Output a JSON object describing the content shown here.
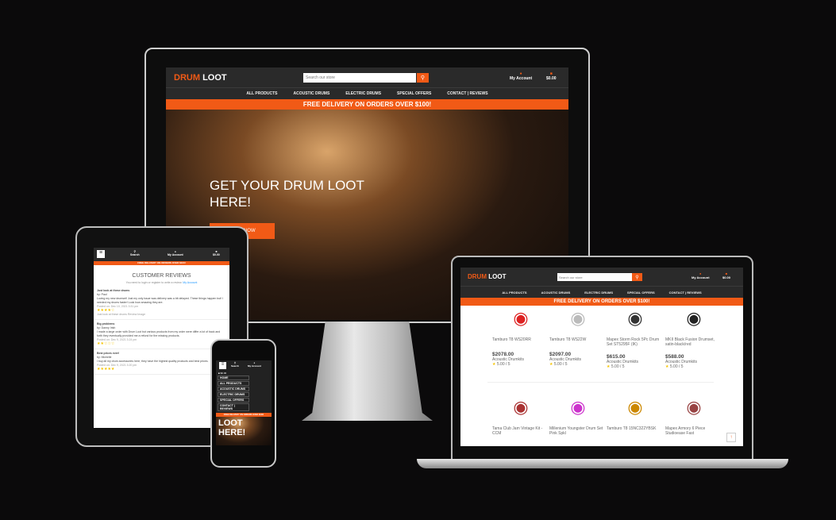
{
  "brand": {
    "part1": "DRUM",
    "part2": "LOOT",
    "accent": "#f15a16"
  },
  "search": {
    "placeholder": "Search our store"
  },
  "header": {
    "account": "My Account",
    "cart": "$0.00",
    "search_label": "Search"
  },
  "nav": [
    "ALL PRODUCTS",
    "ACOUSTIC DRUMS",
    "ELECTRIC DRUMS",
    "SPECIAL OFFERS",
    "CONTACT | REVIEWS"
  ],
  "banner": "FREE DELIVERY ON ORDERS OVER $100!",
  "hero": {
    "title": "GET YOUR DRUM LOOT HERE!",
    "cta": "SHOP NOW"
  },
  "products": [
    {
      "name": "Tamburo T8 WS20RR",
      "price": "$2078.00",
      "category": "Acoustic Drumkits",
      "rating": "5.00 / 5"
    },
    {
      "name": "Tamburo T8 WS22W",
      "price": "$2097.00",
      "category": "Acoustic Drumkits",
      "rating": "5.00 / 5"
    },
    {
      "name": "Mapex Storm Rock 5Pc Drum Set ST5295F (IK)",
      "price": "$615.00",
      "category": "Acoustic Drumkits",
      "rating": "5.00 / 5"
    },
    {
      "name": "MKII Black Fusion Drumset, satin-black/red",
      "price": "$588.00",
      "category": "Acoustic Drumkits",
      "rating": "5.00 / 5"
    },
    {
      "name": "Tama Club Jam Vintage Kit -CCM"
    },
    {
      "name": "Millenium Youngster Drum Set Pink Spkl"
    },
    {
      "name": "Tamburo T8 15NC322YBSK"
    },
    {
      "name": "Mapex Armory 6 Piece Studioease Fast"
    }
  ],
  "reviews": {
    "title": "CUSTOMER REVIEWS",
    "note": "You need to login or register to write a review.",
    "note_link": "My Account",
    "items": [
      {
        "title": "Just look at these drums",
        "author": "by: Paul",
        "body": "Loving my new drumset! Just my only issue was delivery was a bit delayed. These things happen but! I needed my drums faster! Look how amazing they are.",
        "date": "Posted on: Dec 10, 2021 3:31 pm",
        "stars": 4,
        "image_alt": "Just look at these drums Review Image"
      },
      {
        "title": "Big problems",
        "author": "by: Danny Irish",
        "body": "I made a large order with Drum Loot but various products from my order were differ a lot of back and forth they eventually provided me a refund for the missing products.",
        "date": "Posted on: Dec 9, 2021 3:24 pm",
        "stars": 2
      },
      {
        "title": "Best prices ever!",
        "author": "by: Michelle",
        "body": "I buy all my drum accessories here, they have the highest quality products and best prices.",
        "date": "Posted on: Dec 9, 2021 3:20 pm",
        "stars": 5
      }
    ]
  },
  "phone": {
    "menu_home": "HOME",
    "hero_text": "LOOT HERE!"
  }
}
